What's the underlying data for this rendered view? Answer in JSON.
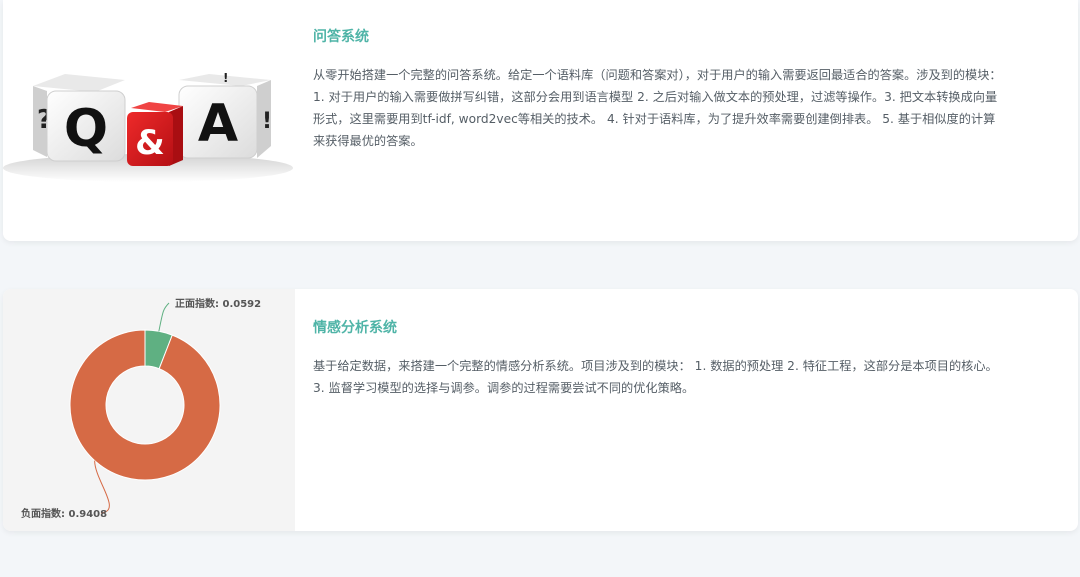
{
  "cards": [
    {
      "title": "问答系统",
      "description": "从零开始搭建一个完整的问答系统。给定一个语料库（问题和答案对），对于用户的输入需要返回最适合的答案。涉及到的模块：1. 对于用户的输入需要做拼写纠错，这部分会用到语言模型 2. 之后对输入做文本的预处理，过滤等操作。3. 把文本转换成向量形式，这里需要用到tf-idf, word2vec等相关的技术。 4. 针对于语料库，为了提升效率需要创建倒排表。 5. 基于相似度的计算来获得最优的答案。",
      "image": {
        "left_cube": "Q",
        "center_cube": "&",
        "right_cube": "A",
        "side_left": "?",
        "side_right": "!",
        "colors": {
          "cube_white": "#f2f2f2",
          "cube_red": "#d6171c",
          "letter": "#111111"
        }
      }
    },
    {
      "title": "情感分析系统",
      "description": "基于给定数据，来搭建一个完整的情感分析系统。项目涉及到的模块： 1. 数据的预处理 2. 特征工程，这部分是本项目的核心。 3. 监督学习模型的选择与调参。调参的过程需要尝试不同的优化策略。"
    }
  ],
  "chart_data": {
    "type": "pie",
    "style": "donut",
    "slices": [
      {
        "label": "正面指数: 0.0592",
        "value": 0.0592,
        "color": "#5fb082"
      },
      {
        "label": "负面指数: 0.9408",
        "value": 0.9408,
        "color": "#d66a45"
      }
    ]
  }
}
